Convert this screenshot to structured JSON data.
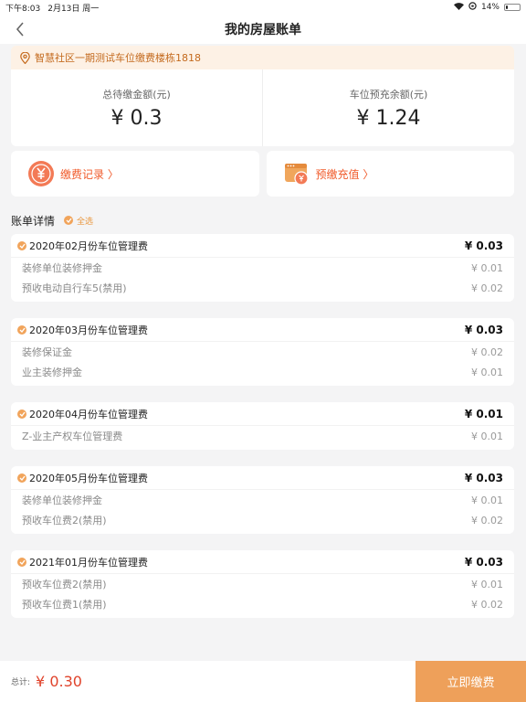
{
  "status": {
    "time": "下午8:03",
    "date": "2月13日 周一",
    "battery": "14%",
    "battery_level": 0.14
  },
  "nav": {
    "title": "我的房屋账单"
  },
  "address": "智慧社区一期测试车位缴费楼栋1818",
  "summary": {
    "pending_label": "总待缴金额(元)",
    "pending_value": "¥ 0.3",
    "balance_label": "车位预充余额(元)",
    "balance_value": "¥ 1.24"
  },
  "actions": {
    "records": "缴费记录 〉",
    "recharge": "预缴充值 〉"
  },
  "bills_section": {
    "title": "账单详情",
    "select_all": "全选"
  },
  "bills": [
    {
      "name": "2020年02月份车位管理费",
      "amount": "¥ 0.03",
      "items": [
        {
          "name": "装修单位装修押金",
          "amount": "¥ 0.01"
        },
        {
          "name": "预收电动自行车5(禁用)",
          "amount": "¥ 0.02"
        }
      ]
    },
    {
      "name": "2020年03月份车位管理费",
      "amount": "¥ 0.03",
      "items": [
        {
          "name": "装修保证金",
          "amount": "¥ 0.02"
        },
        {
          "name": "业主装修押金",
          "amount": "¥ 0.01"
        }
      ]
    },
    {
      "name": "2020年04月份车位管理费",
      "amount": "¥ 0.01",
      "items": [
        {
          "name": "Z-业主产权车位管理费",
          "amount": "¥ 0.01"
        }
      ]
    },
    {
      "name": "2020年05月份车位管理费",
      "amount": "¥ 0.03",
      "items": [
        {
          "name": "装修单位装修押金",
          "amount": "¥ 0.01"
        },
        {
          "name": "预收车位费2(禁用)",
          "amount": "¥ 0.02"
        }
      ]
    },
    {
      "name": "2021年01月份车位管理费",
      "amount": "¥ 0.03",
      "items": [
        {
          "name": "预收车位费2(禁用)",
          "amount": "¥ 0.01"
        },
        {
          "name": "预收车位费1(禁用)",
          "amount": "¥ 0.02"
        }
      ]
    }
  ],
  "footer": {
    "total_label": "总计:",
    "total_value": "¥ 0.30",
    "pay_button": "立即缴费"
  },
  "colors": {
    "accent": "#eea05a",
    "primary_text_orange": "#f05a2a",
    "total_red": "#e0432b"
  }
}
